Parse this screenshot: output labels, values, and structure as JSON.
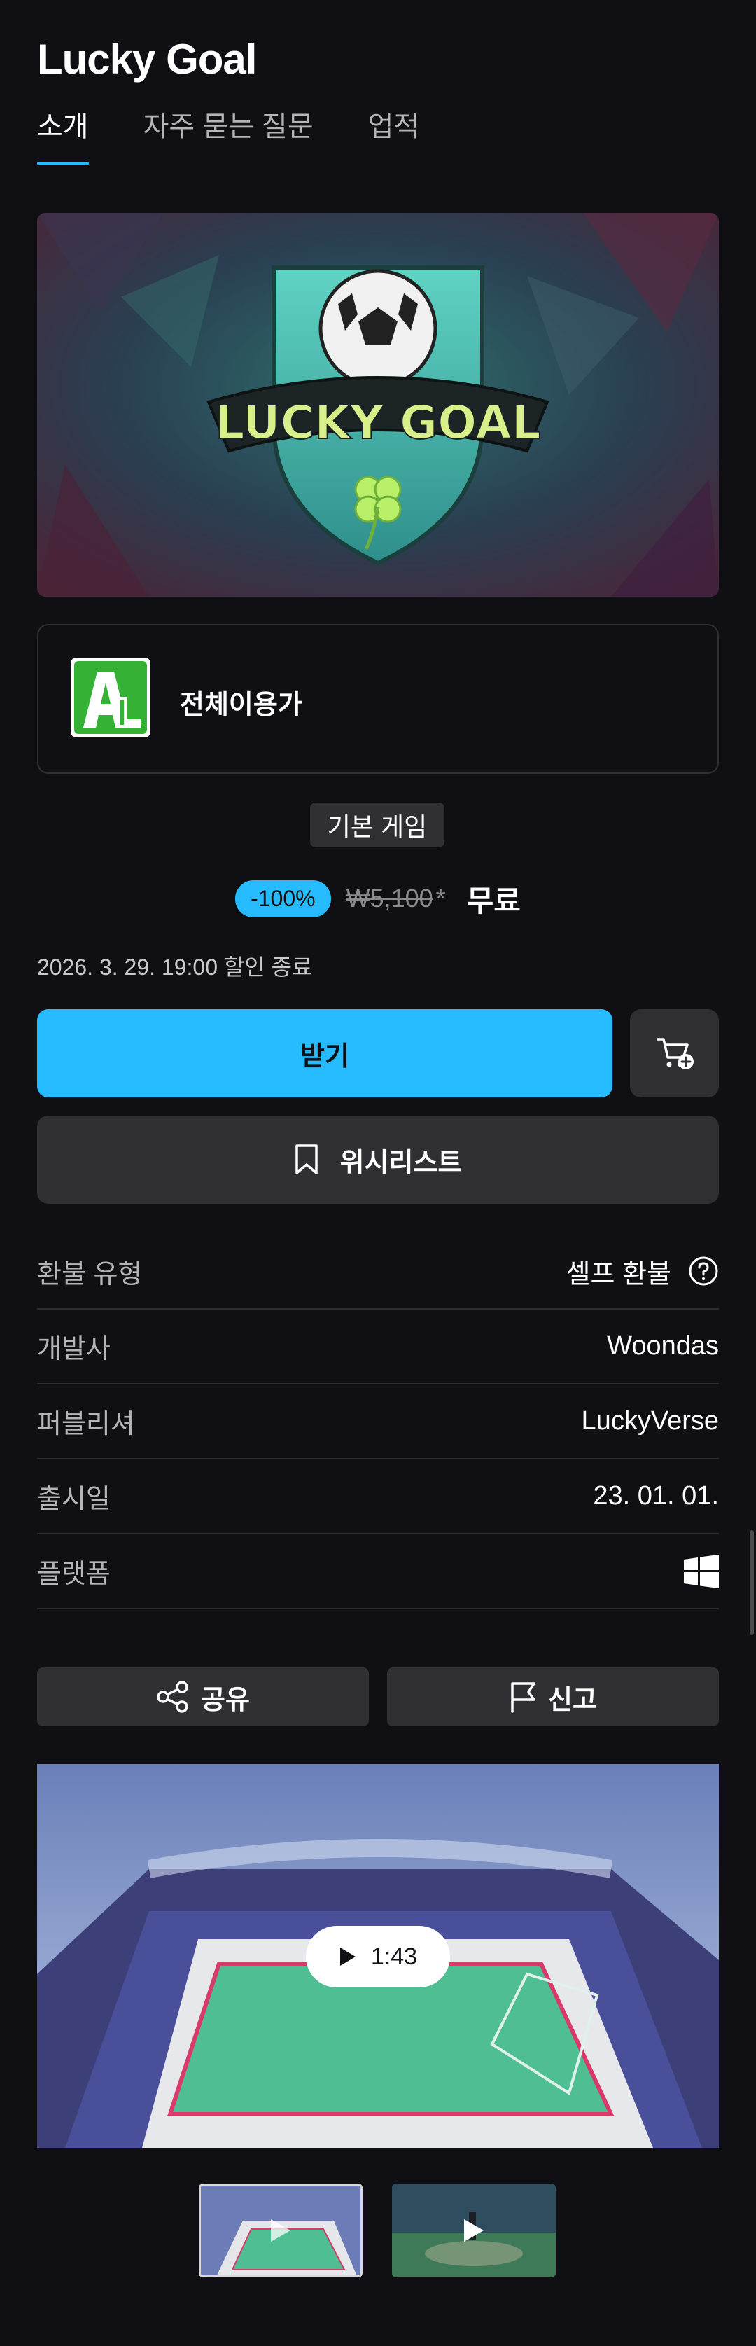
{
  "app": {
    "title": "Lucky Goal"
  },
  "tabs": [
    {
      "label": "소개",
      "active": true
    },
    {
      "label": "자주 묻는 질문",
      "active": false
    },
    {
      "label": "업적",
      "active": false
    }
  ],
  "hero": {
    "logo_text": "LUCKY GOAL"
  },
  "rating": {
    "label": "전체이용가",
    "icon": "age-rating-all-icon"
  },
  "product": {
    "type_badge": "기본 게임"
  },
  "price": {
    "discount": "-100%",
    "original": "₩5,100",
    "asterisk": "*",
    "current": "무료",
    "sale_end": "2026. 3. 29. 19:00 할인 종료"
  },
  "actions": {
    "get_label": "받기",
    "cart_icon": "add-to-cart-icon",
    "wishlist_label": "위시리스트",
    "share_label": "공유",
    "report_label": "신고"
  },
  "info": {
    "refund_label": "환불 유형",
    "refund_value": "셀프 환불",
    "developer_label": "개발사",
    "developer_value": "Woondas",
    "publisher_label": "퍼블리셔",
    "publisher_value": "LuckyVerse",
    "release_label": "출시일",
    "release_value": "23. 01. 01.",
    "platform_label": "플랫폼",
    "platform_icon": "windows-icon"
  },
  "media": {
    "duration": "1:43",
    "thumbnails": [
      "stadium-video",
      "player-video"
    ]
  },
  "colors": {
    "accent": "#26bbff",
    "background": "#101014",
    "surface": "#303034"
  }
}
